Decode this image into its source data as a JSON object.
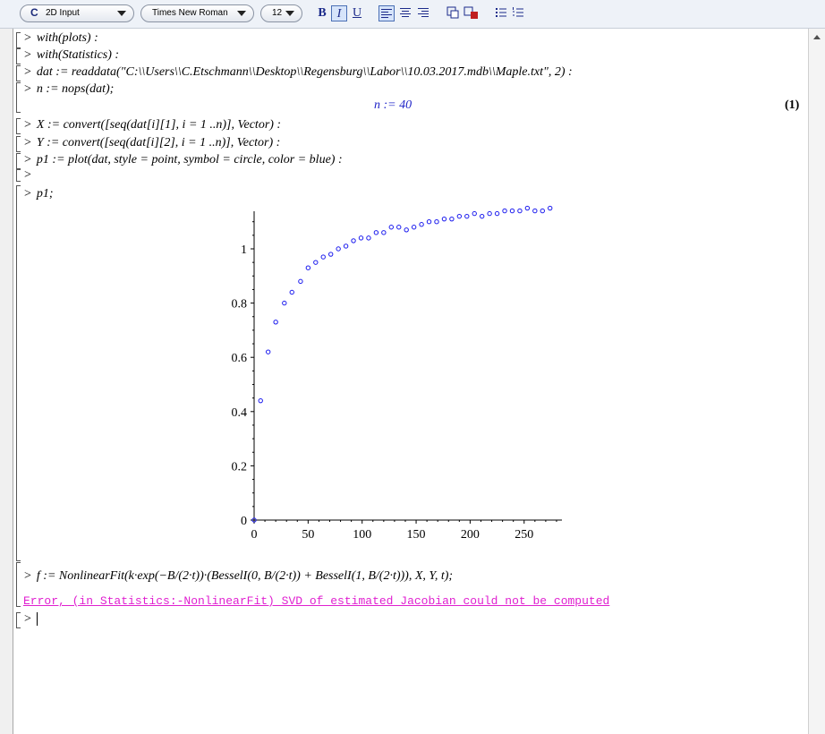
{
  "toolbar": {
    "mode_label": "2D Input",
    "font_label": "Times New Roman",
    "size_label": "12",
    "bold": "B",
    "italic": "I",
    "underline": "U"
  },
  "worksheet": {
    "prompt": ">",
    "lines": [
      "with(plots) :",
      "with(Statistics) :",
      "dat := readdata(\"C:\\\\Users\\\\C.Etschmann\\\\Desktop\\\\Regensburg\\\\Labor\\\\10.03.2017.mdb\\\\Maple.txt\", 2) :",
      "n := nops(dat);",
      "X := convert([seq(dat[i][1], i = 1 ..n)], Vector) :",
      "Y := convert([seq(dat[i][2], i = 1 ..n)], Vector) :",
      "p1 := plot(dat, style = point, symbol = circle, color = blue) :",
      "",
      "p1;"
    ],
    "output_n": "n := 40",
    "equation_label": "(1)",
    "fit_command": "f := NonlinearFit(k·exp(−B/(2·t))·(BesselI(0, B/(2·t)) + BesselI(1, B/(2·t))), X, Y, t);",
    "error_message": "Error, (in Statistics:-NonlinearFit) SVD of estimated Jacobian could not be computed"
  },
  "colors": {
    "output_blue": "#1f24c8",
    "error_magenta": "#e020d0",
    "point_blue": "#1a1aee"
  },
  "chart_data": {
    "type": "scatter",
    "title": "",
    "xlabel": "",
    "ylabel": "",
    "xlim": [
      0,
      285
    ],
    "ylim": [
      0,
      1.18
    ],
    "xticks": [
      0,
      50,
      100,
      150,
      200,
      250
    ],
    "yticks": [
      0,
      0.2,
      0.4,
      0.6,
      0.8,
      1
    ],
    "xtick_labels": [
      "0",
      "50",
      "100",
      "150",
      "200",
      "250"
    ],
    "ytick_labels": [
      "0",
      "0.2",
      "0.4",
      "0.6",
      "0.8",
      "1"
    ],
    "grid": false,
    "series": [
      {
        "x": [
          0,
          6,
          13,
          20,
          28,
          35,
          43,
          50,
          57,
          64,
          71,
          78,
          85,
          92,
          99,
          106,
          113,
          120,
          127,
          134,
          141,
          148,
          155,
          162,
          169,
          176,
          183,
          190,
          197,
          204,
          211,
          218,
          225,
          232,
          239,
          246,
          253,
          260,
          267,
          274
        ],
        "y": [
          0.0,
          0.44,
          0.62,
          0.73,
          0.8,
          0.84,
          0.88,
          0.93,
          0.95,
          0.97,
          0.98,
          1.0,
          1.01,
          1.03,
          1.04,
          1.04,
          1.06,
          1.06,
          1.08,
          1.08,
          1.07,
          1.08,
          1.09,
          1.1,
          1.1,
          1.11,
          1.11,
          1.12,
          1.12,
          1.13,
          1.12,
          1.13,
          1.13,
          1.14,
          1.14,
          1.14,
          1.15,
          1.14,
          1.14,
          1.15
        ]
      }
    ]
  }
}
